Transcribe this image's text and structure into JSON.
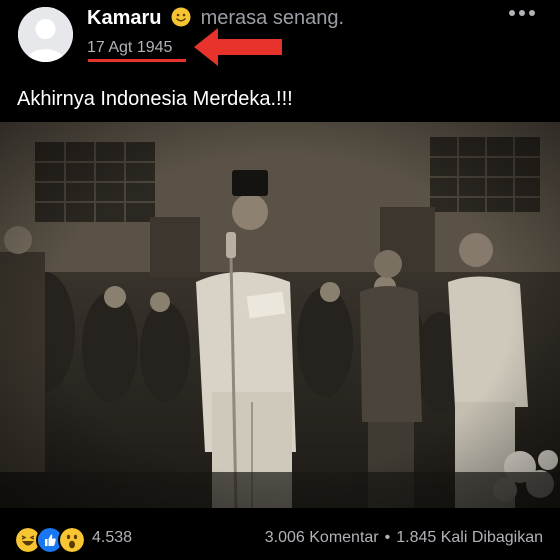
{
  "post": {
    "author": "Kamaru",
    "feeling": "merasa senang.",
    "date": "17 Agt 1945",
    "text": "Akhirnya Indonesia Merdeka.!!!"
  },
  "footer": {
    "reaction_count": "4.538",
    "comments": "3.006 Komentar",
    "separator": "•",
    "shares": "1.845 Kali Dibagikan"
  },
  "icons": {
    "feeling": "smile-emoji-icon",
    "menu": "more-options-icon",
    "annotation": "red-arrow-icon",
    "reactions": [
      "haha-reaction-icon",
      "like-reaction-icon",
      "wow-reaction-icon"
    ]
  },
  "colors": {
    "background": "#000000",
    "annotation": "#e8332c",
    "secondary_text": "#b0b3b8",
    "like_blue": "#1877f2",
    "emoji_yellow": "#f7c531"
  }
}
